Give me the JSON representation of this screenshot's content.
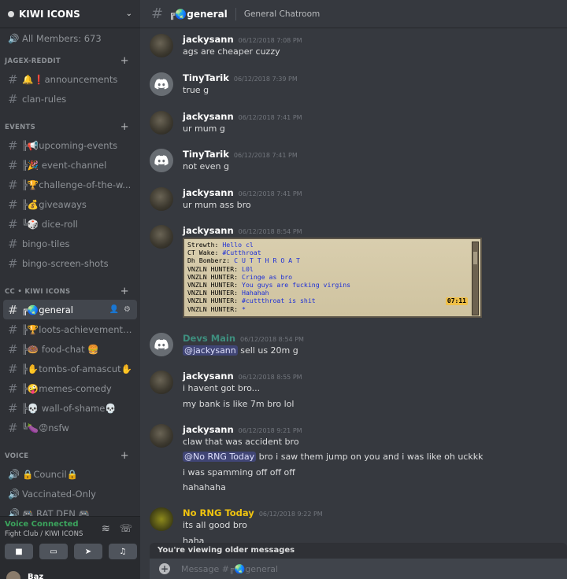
{
  "server": {
    "name": "KIWI ICONS"
  },
  "members_label": "All Members: 673",
  "categories": {
    "jagex": "JAGEX-REDDIT",
    "events": "EVENTS",
    "cc": "CC • KIWI ICONS",
    "voice": "VOICE"
  },
  "channels": {
    "announcements": "🔔❗announcements",
    "clan_rules": "clan-rules",
    "upcoming_events": "╠📢upcoming-events",
    "event_channel": "╠🎉 event-channel",
    "challenge": "╠🏆challenge-of-the-w...",
    "giveaways": "╠💰giveaways",
    "dice_roll": "╚🎲 dice-roll",
    "bingo_tiles": "bingo-tiles",
    "bingo_screens": "bingo-screen-shots",
    "general": "╔🌏general",
    "loots": "╠🏆loots-achievements...",
    "food_chat": "╠🍩 food-chat 🍔",
    "toa": "╠✋tombs-of-amascut✋",
    "memes": "╠🤪meme s-comedy",
    "shame": "╠💀 wall-of-shame💀",
    "nsfw": "╚🍆😡nsfw"
  },
  "voice_channels": {
    "council": "🔒Council🔒",
    "vaccinated": "Vaccinated-Only",
    "rat_den": "🎮 RAT DEN 🎮"
  },
  "voice_status": {
    "title": "Voice Connected",
    "sub": "Fight Club / KIWI ICONS"
  },
  "user": {
    "name": "Baz"
  },
  "header": {
    "channel": "╔🌏general",
    "topic": "General Chatroom"
  },
  "messages": [
    {
      "author": "jackysann",
      "time": "06/12/2018 7:08 PM",
      "lines": [
        "ags are cheaper cuzzy"
      ]
    },
    {
      "author": "TinyTarik",
      "time": "06/12/2018 7:39 PM",
      "lines": [
        "true g"
      ]
    },
    {
      "author": "jackysann",
      "time": "06/12/2018 7:41 PM",
      "lines": [
        "ur mum g"
      ]
    },
    {
      "author": "TinyTarik",
      "time": "06/12/2018 7:41 PM",
      "lines": [
        "not even g"
      ]
    },
    {
      "author": "jackysann",
      "time": "06/12/2018 7:41 PM",
      "lines": [
        "ur mum ass bro"
      ]
    },
    {
      "author": "jackysann",
      "time": "06/12/2018 8:54 PM"
    },
    {
      "author": "Devs Main",
      "time": "06/12/2018 8:54 PM",
      "mention": "@jackysann",
      "text": "sell us 20m g",
      "color": "#3e8e7e"
    },
    {
      "author": "jackysann",
      "time": "06/12/2018 8:55 PM",
      "lines": [
        "i havent got bro...",
        "my bank is like  7m bro lol"
      ]
    },
    {
      "author": "jackysann",
      "time": "06/12/2018 9:21 PM",
      "lines": [
        "claw that was accident bro",
        "",
        "i was spamming off off off",
        "hahahaha"
      ],
      "mention": "@No RNG Today",
      "mention_text": "bro i saw them jump on you and i was like oh uckkk"
    },
    {
      "author": "No RNG Today",
      "time": "06/12/2018 9:22 PM",
      "lines": [
        "its all good bro",
        "haha"
      ],
      "color": "#f1c40f"
    }
  ],
  "osrs_chat": [
    {
      "name": "Strewth:",
      "text": "Hello cl"
    },
    {
      "name": "CT Wake:",
      "text": "#Cutthroat"
    },
    {
      "name": "Dh Bomberz:",
      "text": "C U T T H R O A T"
    },
    {
      "name": "VNZLN HUNTER:",
      "text": "L0l"
    },
    {
      "name": "VNZLN HUNTER:",
      "text": "Cringe as bro"
    },
    {
      "name": "VNZLN HUNTER:",
      "text": "You guys are fucking virgins"
    },
    {
      "name": "VNZLN HUNTER:",
      "text": "Hahahah"
    },
    {
      "name": "VNZLN HUNTER:",
      "text": "#cuttthroat is shit"
    },
    {
      "name": "VNZLN HUNTER:",
      "text": "*"
    }
  ],
  "osrs_clock": "07:11",
  "older_notice": "You're viewing older messages",
  "composer": {
    "placeholder": "Message #╔🌏general"
  },
  "colors": {
    "accent": "#5865f2",
    "voice_green": "#3ba55d",
    "sidebar": "#2f3136",
    "main": "#36393f"
  }
}
